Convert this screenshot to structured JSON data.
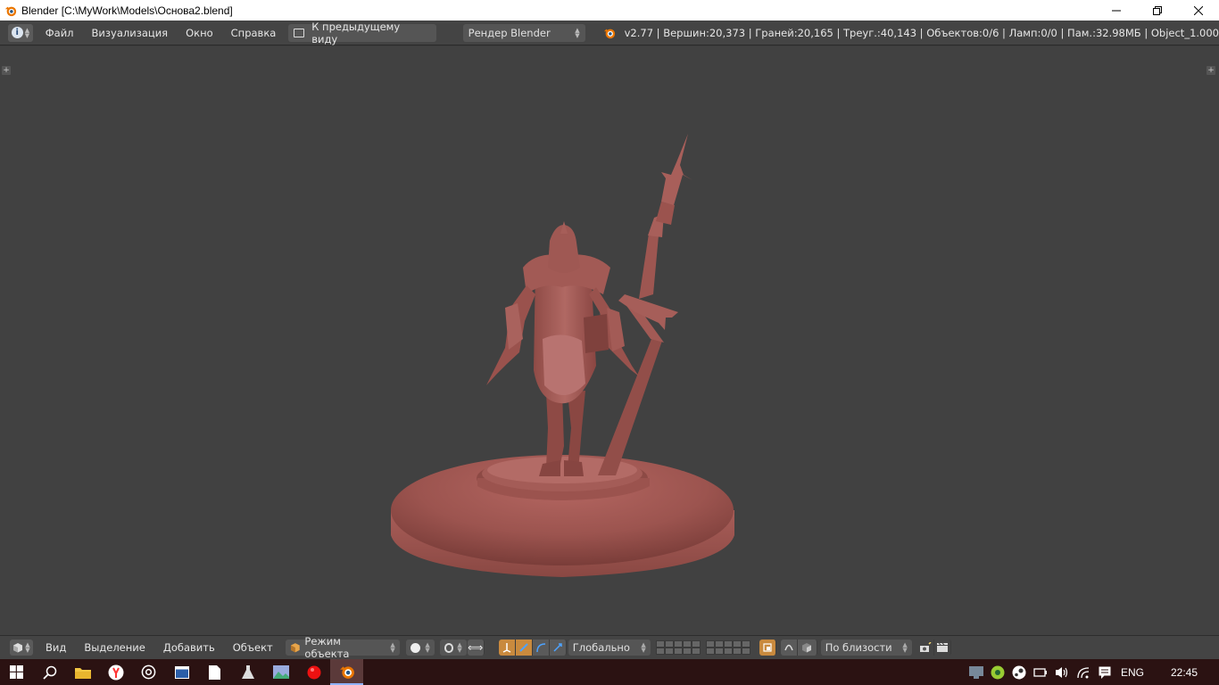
{
  "window": {
    "title": "Blender [C:\\MyWork\\Models\\Основа2.blend]",
    "minimize_icon": "minimize-icon",
    "maximize_icon": "restore-icon",
    "close_icon": "close-icon"
  },
  "info_header": {
    "menus": [
      "Файл",
      "Визуализация",
      "Окно",
      "Справка"
    ],
    "back_button": "К предыдущему виду",
    "render_engine": "Рендер Blender",
    "stats": "v2.77 | Вершин:20,373 | Граней:20,165 | Треуг.:40,143 | Объектов:0/6 | Ламп:0/0 | Пам.:32.98МБ | Object_1.000"
  },
  "viewport": {
    "model_color": "#a35a55",
    "background_color": "#414141"
  },
  "view3d_header": {
    "menus": [
      "Вид",
      "Выделение",
      "Добавить",
      "Объект"
    ],
    "mode": "Режим объекта",
    "transform_orientation": "Глобально",
    "snap_target": "По близости"
  },
  "taskbar": {
    "apps": [
      "start-icon",
      "search-icon",
      "file-explorer-icon",
      "yandex-browser-icon",
      "music-icon",
      "window-icon",
      "document-icon",
      "flask-icon",
      "image-viewer-icon",
      "record-icon",
      "blender-icon"
    ],
    "language": "ENG",
    "time": "22:45"
  }
}
